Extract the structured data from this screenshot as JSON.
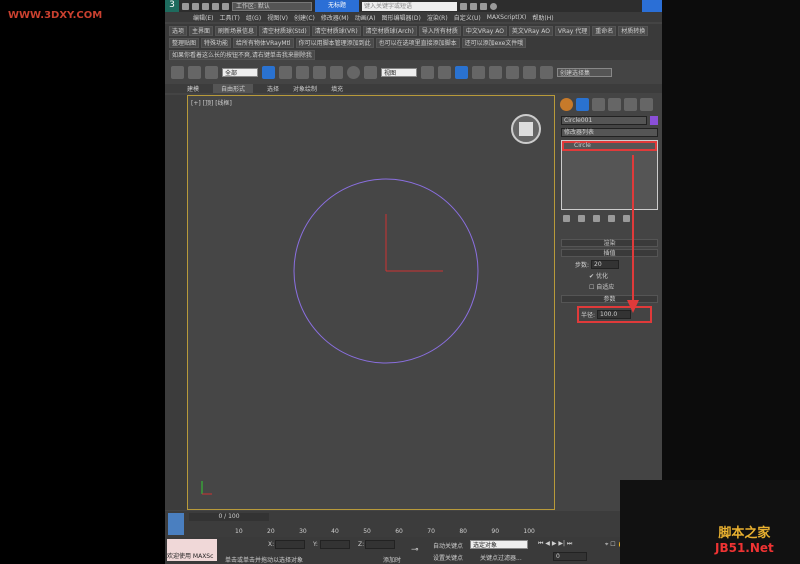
{
  "watermark_top": "WWW.3DXY.COM",
  "watermark_bottom": {
    "line1": "脚本之家",
    "line2": "JB51.Net"
  },
  "titlebar": {
    "workspace": "工作区: 默认",
    "title": "无标题",
    "search_placeholder": "键入关键字或短语"
  },
  "menu": [
    "编辑(E)",
    "工具(T)",
    "组(G)",
    "视图(V)",
    "创建(C)",
    "修改器(M)",
    "动画(A)",
    "图形编辑器(D)",
    "渲染(R)",
    "自定义(U)",
    "MAXScript(X)",
    "帮助(H)"
  ],
  "script_buttons": [
    "选项",
    "主界面",
    "刷新场景信息",
    "清空材质球(Std)",
    "清空材质球(VR)",
    "清空材质球(Arch)",
    "导入所有材质",
    "中文VRay AO",
    "英文VRay AO",
    "VRay 代理",
    "重命名",
    "材质转换",
    "整理贴图",
    "特殊功能",
    "给所有物体VRayMtl",
    "你可以用脚本管理添加到此",
    "也可以在选项里直接添加脚本",
    "还可以添加exe文件哦",
    "如果你看着这么长的按钮不爽,请右键单击我来删除我"
  ],
  "toolbar": {
    "filter": "全部",
    "refcoord": "视图",
    "selset": "创建选择集"
  },
  "ribbon_tabs": [
    "建模",
    "自由形式",
    "选择",
    "对象绘制",
    "填充"
  ],
  "viewport": {
    "label": "[+] [顶] [线框]"
  },
  "command_panel": {
    "object_name": "Circle001",
    "modifier_list": "修改器列表",
    "stack_item": "Circle",
    "rollouts": {
      "render": "渲染",
      "interp": "插值",
      "steps_label": "步数:",
      "steps": "20",
      "optimize": "优化",
      "adaptive": "自适应",
      "params": "参数",
      "radius_label": "半径:",
      "radius": "100.0"
    },
    "object_color": "#8a4fd8"
  },
  "timeline": {
    "frame": "0 / 100",
    "ticks": [
      "10",
      "20",
      "30",
      "40",
      "50",
      "60",
      "70",
      "80",
      "90",
      "100"
    ]
  },
  "status": {
    "welcome": "欢迎使用 MAXSc",
    "prompt": "单击或单击并拖动以选择对象",
    "x": "X:",
    "y": "Y:",
    "z": "Z:",
    "add_time_tag": "添加时",
    "autokey": "自动关键点",
    "selected": "选定对象",
    "setkey": "设置关键点",
    "key_filters": "关键点过滤器...",
    "frame_field": "0"
  }
}
